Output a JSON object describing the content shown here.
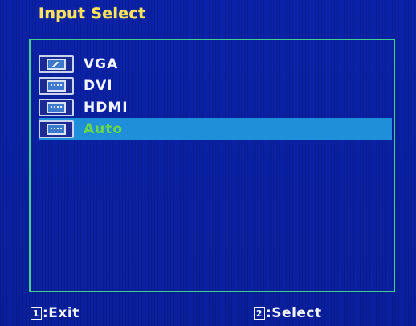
{
  "osd": {
    "title": "Input Select",
    "colors": {
      "background": "#0a1f9e",
      "title": "#ffe35a",
      "frame": "#3fd28a",
      "highlight": "#1e8fd8",
      "selected_text": "#69d94a",
      "text": "#f2f4ff"
    }
  },
  "menu": {
    "items": [
      {
        "label": "VGA",
        "icon": "vga-port-icon"
      },
      {
        "label": "DVI",
        "icon": "dvi-port-icon"
      },
      {
        "label": "HDMI",
        "icon": "hdmi-port-icon"
      },
      {
        "label": "Auto",
        "icon": "auto-input-icon",
        "selected": true
      }
    ]
  },
  "footer": {
    "exit_key": "1",
    "exit_label": ":Exit",
    "select_key": "2",
    "select_label": ":Select"
  }
}
